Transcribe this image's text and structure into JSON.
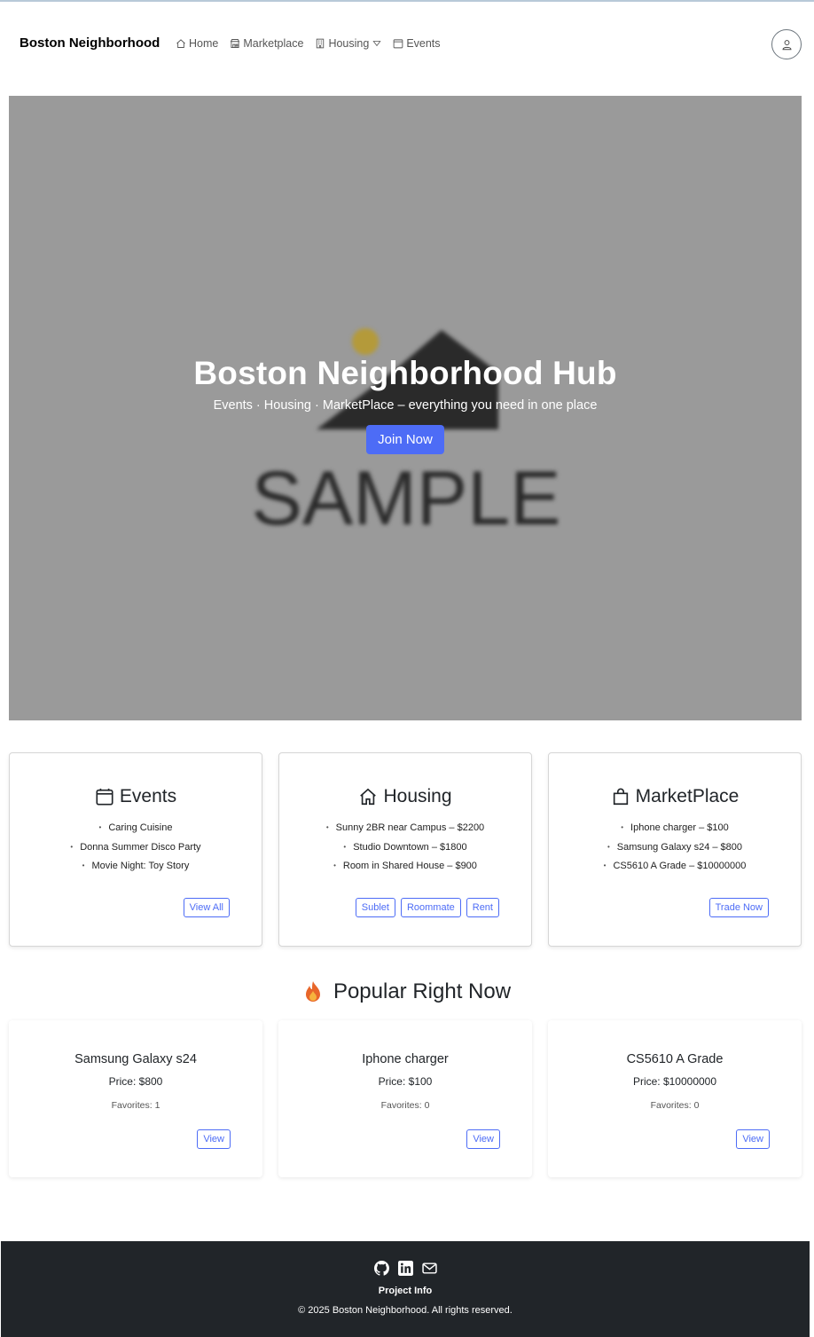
{
  "navbar": {
    "brand": "Boston Neighborhood",
    "items": [
      {
        "label": "Home",
        "icon": "home-icon"
      },
      {
        "label": "Marketplace",
        "icon": "shop-icon"
      },
      {
        "label": "Housing",
        "icon": "building-icon",
        "dropdown": true
      },
      {
        "label": "Events",
        "icon": "calendar-icon"
      }
    ],
    "profile_icon": "person-icon"
  },
  "hero": {
    "title": "Boston Neighborhood Hub",
    "subtitle": "Events · Housing · MarketPlace – everything you need in one place",
    "button": "Join Now",
    "image_text": "SAMPLE",
    "button_color": "#4d6cf6"
  },
  "cards": [
    {
      "title": "Events",
      "icon": "calendar-icon",
      "items": [
        "Caring Cuisine",
        "Donna Summer Disco Party",
        "Movie Night: Toy Story"
      ],
      "buttons": [
        "View All"
      ]
    },
    {
      "title": "Housing",
      "icon": "house-icon",
      "items": [
        "Sunny 2BR near Campus – $2200",
        "Studio Downtown – $1800",
        "Room in Shared House – $900"
      ],
      "buttons": [
        "Sublet",
        "Roommate",
        "Rent"
      ]
    },
    {
      "title": "MarketPlace",
      "icon": "shopping-bag-icon",
      "items": [
        "Iphone charger – $100",
        "Samsung Galaxy s24 – $800",
        "CS5610 A Grade – $10000000"
      ],
      "buttons": [
        "Trade Now"
      ]
    }
  ],
  "popular": {
    "title": "Popular Right Now",
    "icon": "fire-icon",
    "items": [
      {
        "name": "Samsung Galaxy s24",
        "price": "Price: $800",
        "favorites": "Favorites: 1",
        "button": "View"
      },
      {
        "name": "Iphone charger",
        "price": "Price: $100",
        "favorites": "Favorites: 0",
        "button": "View"
      },
      {
        "name": "CS5610 A Grade",
        "price": "Price: $10000000",
        "favorites": "Favorites: 0",
        "button": "View"
      }
    ]
  },
  "footer": {
    "icons": [
      "github-icon",
      "linkedin-icon",
      "envelope-icon"
    ],
    "link": "Project Info",
    "copyright": "© 2025 Boston Neighborhood. All rights reserved.",
    "background": "#212529"
  }
}
